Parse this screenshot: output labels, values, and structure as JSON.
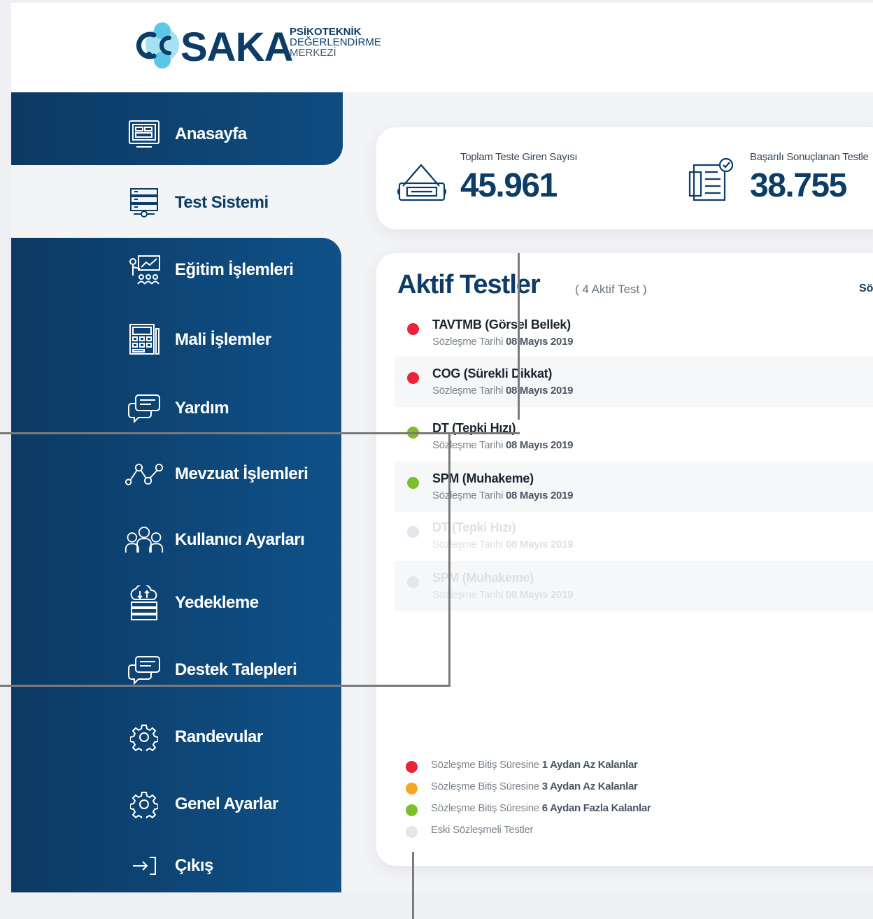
{
  "colors": {
    "brand_dark": "#0d3d66",
    "sidebar_blue": "#0e4c80",
    "red": "#e8233b",
    "orange": "#f5a623",
    "green": "#7cbf2a",
    "grey": "#e3e6ea",
    "logo_cyan": "#5bc8e6"
  },
  "logo": {
    "word": "SAKA",
    "line1": "PSİKOTEKNİK",
    "line2": "DEĞERLENDİRME",
    "line3": "MERKEZİ"
  },
  "sidebar": {
    "items": [
      {
        "label": "Anasayfa",
        "icon": "monitor-icon"
      },
      {
        "label": "Test Sistemi",
        "icon": "server-icon"
      },
      {
        "label": "Eğitim İşlemleri",
        "icon": "presentation-icon"
      },
      {
        "label": "Mali İşlemler",
        "icon": "calculator-icon"
      },
      {
        "label": "Yardım",
        "icon": "chat-icon"
      },
      {
        "label": "Mevzuat İşlemleri",
        "icon": "network-icon"
      },
      {
        "label": "Kullanıcı Ayarları",
        "icon": "users-icon"
      },
      {
        "label": "Yedekleme",
        "icon": "cloud-backup-icon"
      },
      {
        "label": "Destek Talepleri",
        "icon": "support-chat-icon"
      },
      {
        "label": "Randevular",
        "icon": "gear-icon"
      },
      {
        "label": "Genel Ayarlar",
        "icon": "settings-icon"
      },
      {
        "label": "Çıkış",
        "icon": "logout-icon"
      }
    ],
    "active_index": 1
  },
  "stats": [
    {
      "label": "Toplam Teste Giren Sayısı",
      "value": "45.961",
      "icon": "ticket-icon"
    },
    {
      "label": "Başarılı Sonuçlanan Testle",
      "value": "38.755",
      "icon": "certificate-icon"
    }
  ],
  "tests": {
    "title": "Aktif Testler",
    "subtitle": "( 4 Aktif Test )",
    "link": "Sö",
    "date_label": "Sözleşme Tarihi",
    "rows": [
      {
        "name": "TAVTMB (Görsel Bellek)",
        "date": "08 Mayıs 2019",
        "status": "red"
      },
      {
        "name": "COG (Sürekli Dikkat)",
        "date": "08 Mayıs 2019",
        "status": "red"
      },
      {
        "name": "DT (Tepki Hızı)",
        "date": "08 Mayıs 2019",
        "status": "green"
      },
      {
        "name": "SPM (Muhakeme)",
        "date": "08 Mayıs 2019",
        "status": "green"
      },
      {
        "name": "DT (Tepki Hızı)",
        "date": "08 Mayıs 2019",
        "status": "grey"
      },
      {
        "name": "SPM (Muhakeme)",
        "date": "08 Mayıs 2019",
        "status": "grey"
      }
    ]
  },
  "legend": [
    {
      "prefix": "Sözleşme Bitiş Süresine",
      "bold": "1 Aydan Az Kalanlar",
      "status": "red"
    },
    {
      "prefix": "Sözleşme Bitiş Süresine",
      "bold": "3 Aydan Az Kalanlar",
      "status": "orange"
    },
    {
      "prefix": "Sözleşme Bitiş Süresine",
      "bold": "6 Aydan Fazla Kalanlar",
      "status": "green"
    },
    {
      "prefix": "Eski Sözleşmeli Testler",
      "bold": "",
      "status": "grey"
    }
  ]
}
